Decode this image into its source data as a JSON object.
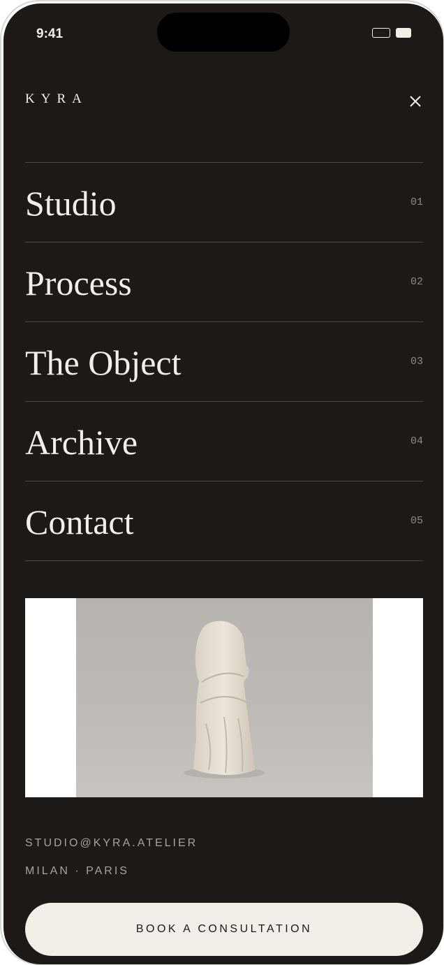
{
  "status_bar": {
    "time": "9:41"
  },
  "header": {
    "brand": "KYRA"
  },
  "nav": {
    "items": [
      {
        "label": "Studio",
        "number": "01"
      },
      {
        "label": "Process",
        "number": "02"
      },
      {
        "label": "The Object",
        "number": "03"
      },
      {
        "label": "Archive",
        "number": "04"
      },
      {
        "label": "Contact",
        "number": "05"
      }
    ]
  },
  "footer": {
    "email": "STUDIO@KYRA.ATELIER",
    "cities": "MILAN · PARIS"
  },
  "cta": {
    "label": "BOOK A CONSULTATION"
  },
  "colors": {
    "background": "#1c1917",
    "text": "#f3efe8",
    "muted": "#8f8983",
    "button": "#f3efe8"
  },
  "icons": [
    "close-icon",
    "battery-icon"
  ]
}
